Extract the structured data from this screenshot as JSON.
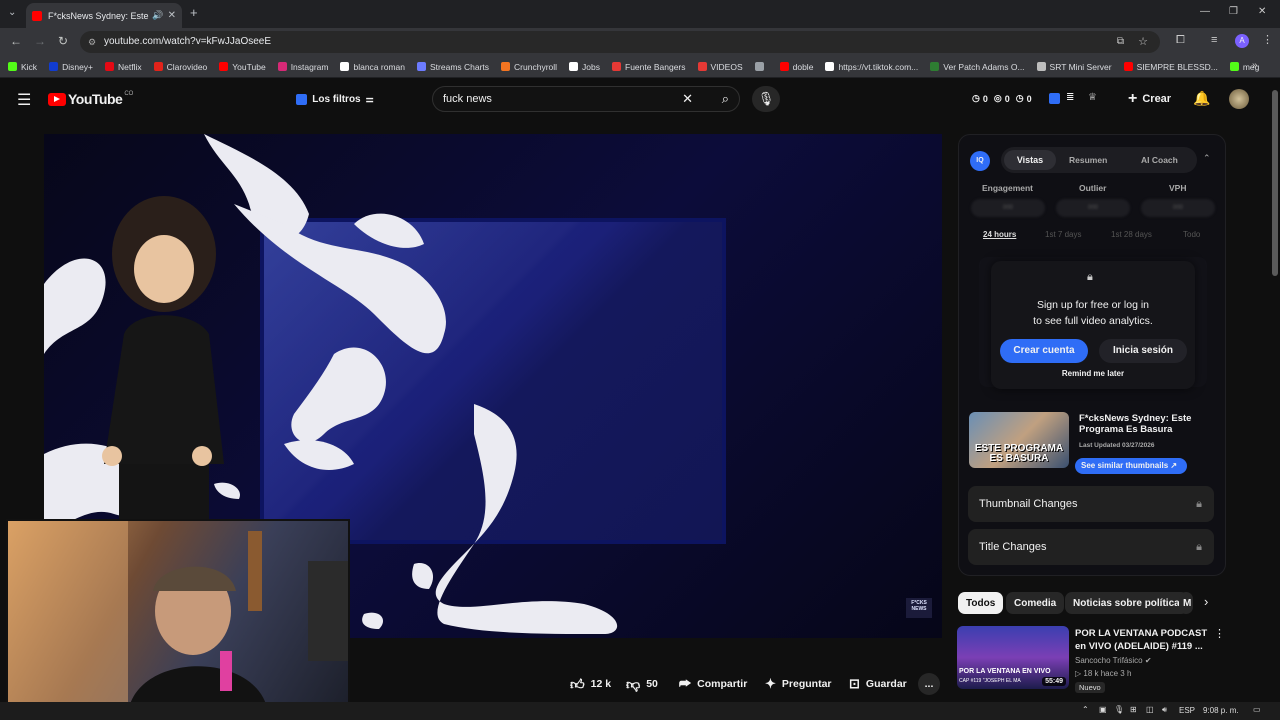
{
  "browser": {
    "tab_title": "F*cksNews Sydney: Este Pr",
    "new_tab": "+",
    "url": "youtube.com/watch?v=kFwJJaOseeE",
    "bookmarks": [
      {
        "label": "Kick",
        "color": "#53fc18"
      },
      {
        "label": "Disney+",
        "color": "#113ccf"
      },
      {
        "label": "Netflix",
        "color": "#e50914"
      },
      {
        "label": "Clarovideo",
        "color": "#e2231a"
      },
      {
        "label": "YouTube",
        "color": "#ff0000"
      },
      {
        "label": "Instagram",
        "color": "#d62976"
      },
      {
        "label": "blanca roman",
        "color": "#ffffff"
      },
      {
        "label": "Streams Charts",
        "color": "#6c7bff"
      },
      {
        "label": "Crunchyroll",
        "color": "#f47521"
      },
      {
        "label": "Jobs",
        "color": "#ffffff"
      },
      {
        "label": "Fuente Bangers",
        "color": "#e53935"
      },
      {
        "label": "VIDEOS",
        "color": "#e53935"
      },
      {
        "label": "",
        "color": "#9aa0a6"
      },
      {
        "label": "doble",
        "color": "#ff0000"
      },
      {
        "label": "https://vt.tiktok.com...",
        "color": "#ffffff"
      },
      {
        "label": "Ver Patch Adams O...",
        "color": "#2e7d32"
      },
      {
        "label": "SRT Mini Server",
        "color": "#bdbdbd"
      },
      {
        "label": "SIEMPRE BLESSD...",
        "color": "#ff0000"
      },
      {
        "label": "meg",
        "color": "#53fc18"
      }
    ]
  },
  "youtube": {
    "logo": "YouTube",
    "country": "CO",
    "filters_label": "Los filtros",
    "search_value": "fuck news",
    "header_counters": [
      "0",
      "0",
      "0"
    ],
    "create_label": "Crear",
    "video_watermark": "F*CKS NEWS"
  },
  "actions": {
    "likes": "12 k",
    "dislikes": "50",
    "share": "Compartir",
    "ask": "Preguntar",
    "save": "Guardar",
    "more": "..."
  },
  "panel": {
    "tabs": [
      "Vistas",
      "Resumen",
      "AI Coach"
    ],
    "metrics": [
      "Engagement",
      "Outlier",
      "VPH"
    ],
    "metric_values": [
      "000",
      "000",
      "000"
    ],
    "ranges": [
      "24 hours",
      "1st 7 days",
      "1st 28 days",
      "Todo"
    ],
    "signup_line1": "Sign up for free or log in",
    "signup_line2": "to see full video analytics.",
    "create_account": "Crear cuenta",
    "login": "Inicia sesión",
    "remind": "Remind me later",
    "video_title": "F*cksNews Sydney: Este Programa Es Basura",
    "last_updated": "Last Updated 03/27/2026",
    "similar_thumbs": "See similar thumbnails",
    "thumb_text": "ESTE PROGRAMA ES BASURA",
    "thumbnail_changes": "Thumbnail Changes",
    "title_changes": "Title Changes"
  },
  "chips": [
    "Todos",
    "Comedia",
    "Noticias sobre política",
    "M"
  ],
  "recommendation": {
    "title": "POR LA VENTANA PODCAST en VIVO (ADELAIDE) #119 ...",
    "channel": "Sancocho Trifásico",
    "stats": "18 k  hace 3 h",
    "badge": "Nuevo",
    "duration": "55:49",
    "thumb_text": "POR LA VENTANA EN VIVO",
    "thumb_sub": "CAP #119 \"JOSEPH EL MA"
  },
  "taskbar": {
    "lang": "ESP",
    "time": "9:08 p. m."
  }
}
